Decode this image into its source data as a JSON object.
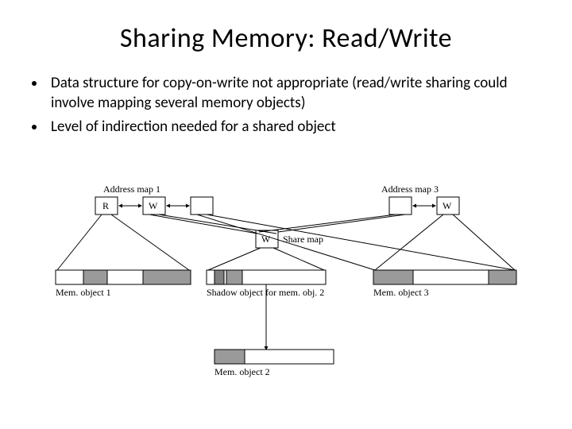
{
  "title": "Sharing Memory: Read/Write",
  "bullets": [
    "Data structure for copy-on-write not appropriate (read/write sharing could involve mapping several memory objects)",
    "Level of indirection needed for a shared object"
  ],
  "fig": {
    "addrmap1": "Address map 1",
    "addrmap3": "Address map 3",
    "r": "R",
    "w": "W",
    "sharemap": "Share map",
    "memobj1": "Mem. object 1",
    "memobj2": "Mem. object 2",
    "memobj3": "Mem. object 3",
    "shadow": "Shadow object for mem. obj. 2"
  }
}
